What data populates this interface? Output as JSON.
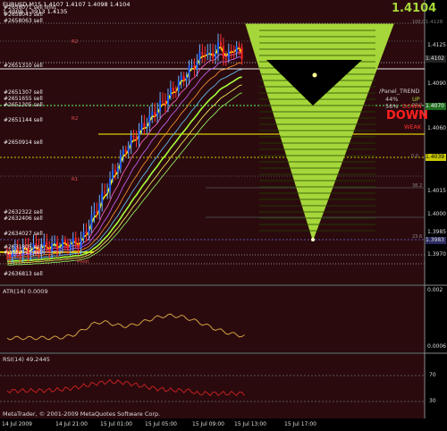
{
  "header": {
    "line1": "EURUSD,M15  1.4107 1.4107 1.4098 1.4104",
    "line2": "1.4009 1.3913 1.4135",
    "current_price": "1.4104"
  },
  "orders": [
    "#2658071 sell limit",
    "#2658043 sell",
    "#2658063 sell",
    "#2651310 sell",
    "#2651307 sell",
    "#2651655 sell",
    "#2651305 sell",
    "#2651144 sell",
    "#2650914 sell",
    "#2632322 sell",
    "#2632406 sell",
    "#2634027 sell",
    "#2631805 sell",
    "#2632413 sell",
    "#2636813 sell"
  ],
  "level_labels": [
    "R2",
    "R2",
    "R1",
    "Pivot"
  ],
  "price_axis": [
    "1.4125",
    "1.4090",
    "1.4060",
    "1.4015",
    "1.4000",
    "1.3985",
    "1.3970"
  ],
  "price_tags": {
    "top": "1.4128",
    "mid": "1.4102",
    "green": "1.4070",
    "yellow": "1.4039",
    "gray": "1.3983"
  },
  "axis_small_labels": [
    "100.0",
    "50.0",
    "38.2",
    "23.6",
    "0.0"
  ],
  "panel": {
    "title": "/Panel_TREND",
    "up_pct": "44%",
    "up_label": "UP",
    "down_pct": "56%",
    "down_label": "DOWN",
    "big_label": "DOWN",
    "weak_label": "WEAK"
  },
  "atr": {
    "label": "ATR(14) 0.0009",
    "axis_top": "0.002",
    "axis_bottom": "0.0006"
  },
  "rsi": {
    "label": "RSI(14) 49.2445",
    "axis_top": "70",
    "axis_bottom": "30"
  },
  "copyright": "MetaTrader, © 2001-2009 MetaQuotes Software Corp.",
  "time_axis": [
    "14 Jul 2009",
    "14 Jul 21:00",
    "15 Jul 01:00",
    "15 Jul 05:00",
    "15 Jul 09:00",
    "15 Jul 13:00",
    "15 Jul 17:00"
  ],
  "colors": {
    "background": "#000000",
    "plot_bg": "#2b0a0e",
    "green_accent": "#a6d73a",
    "yellow": "#ffff00",
    "red": "#ff2020",
    "grid": "#444444"
  }
}
